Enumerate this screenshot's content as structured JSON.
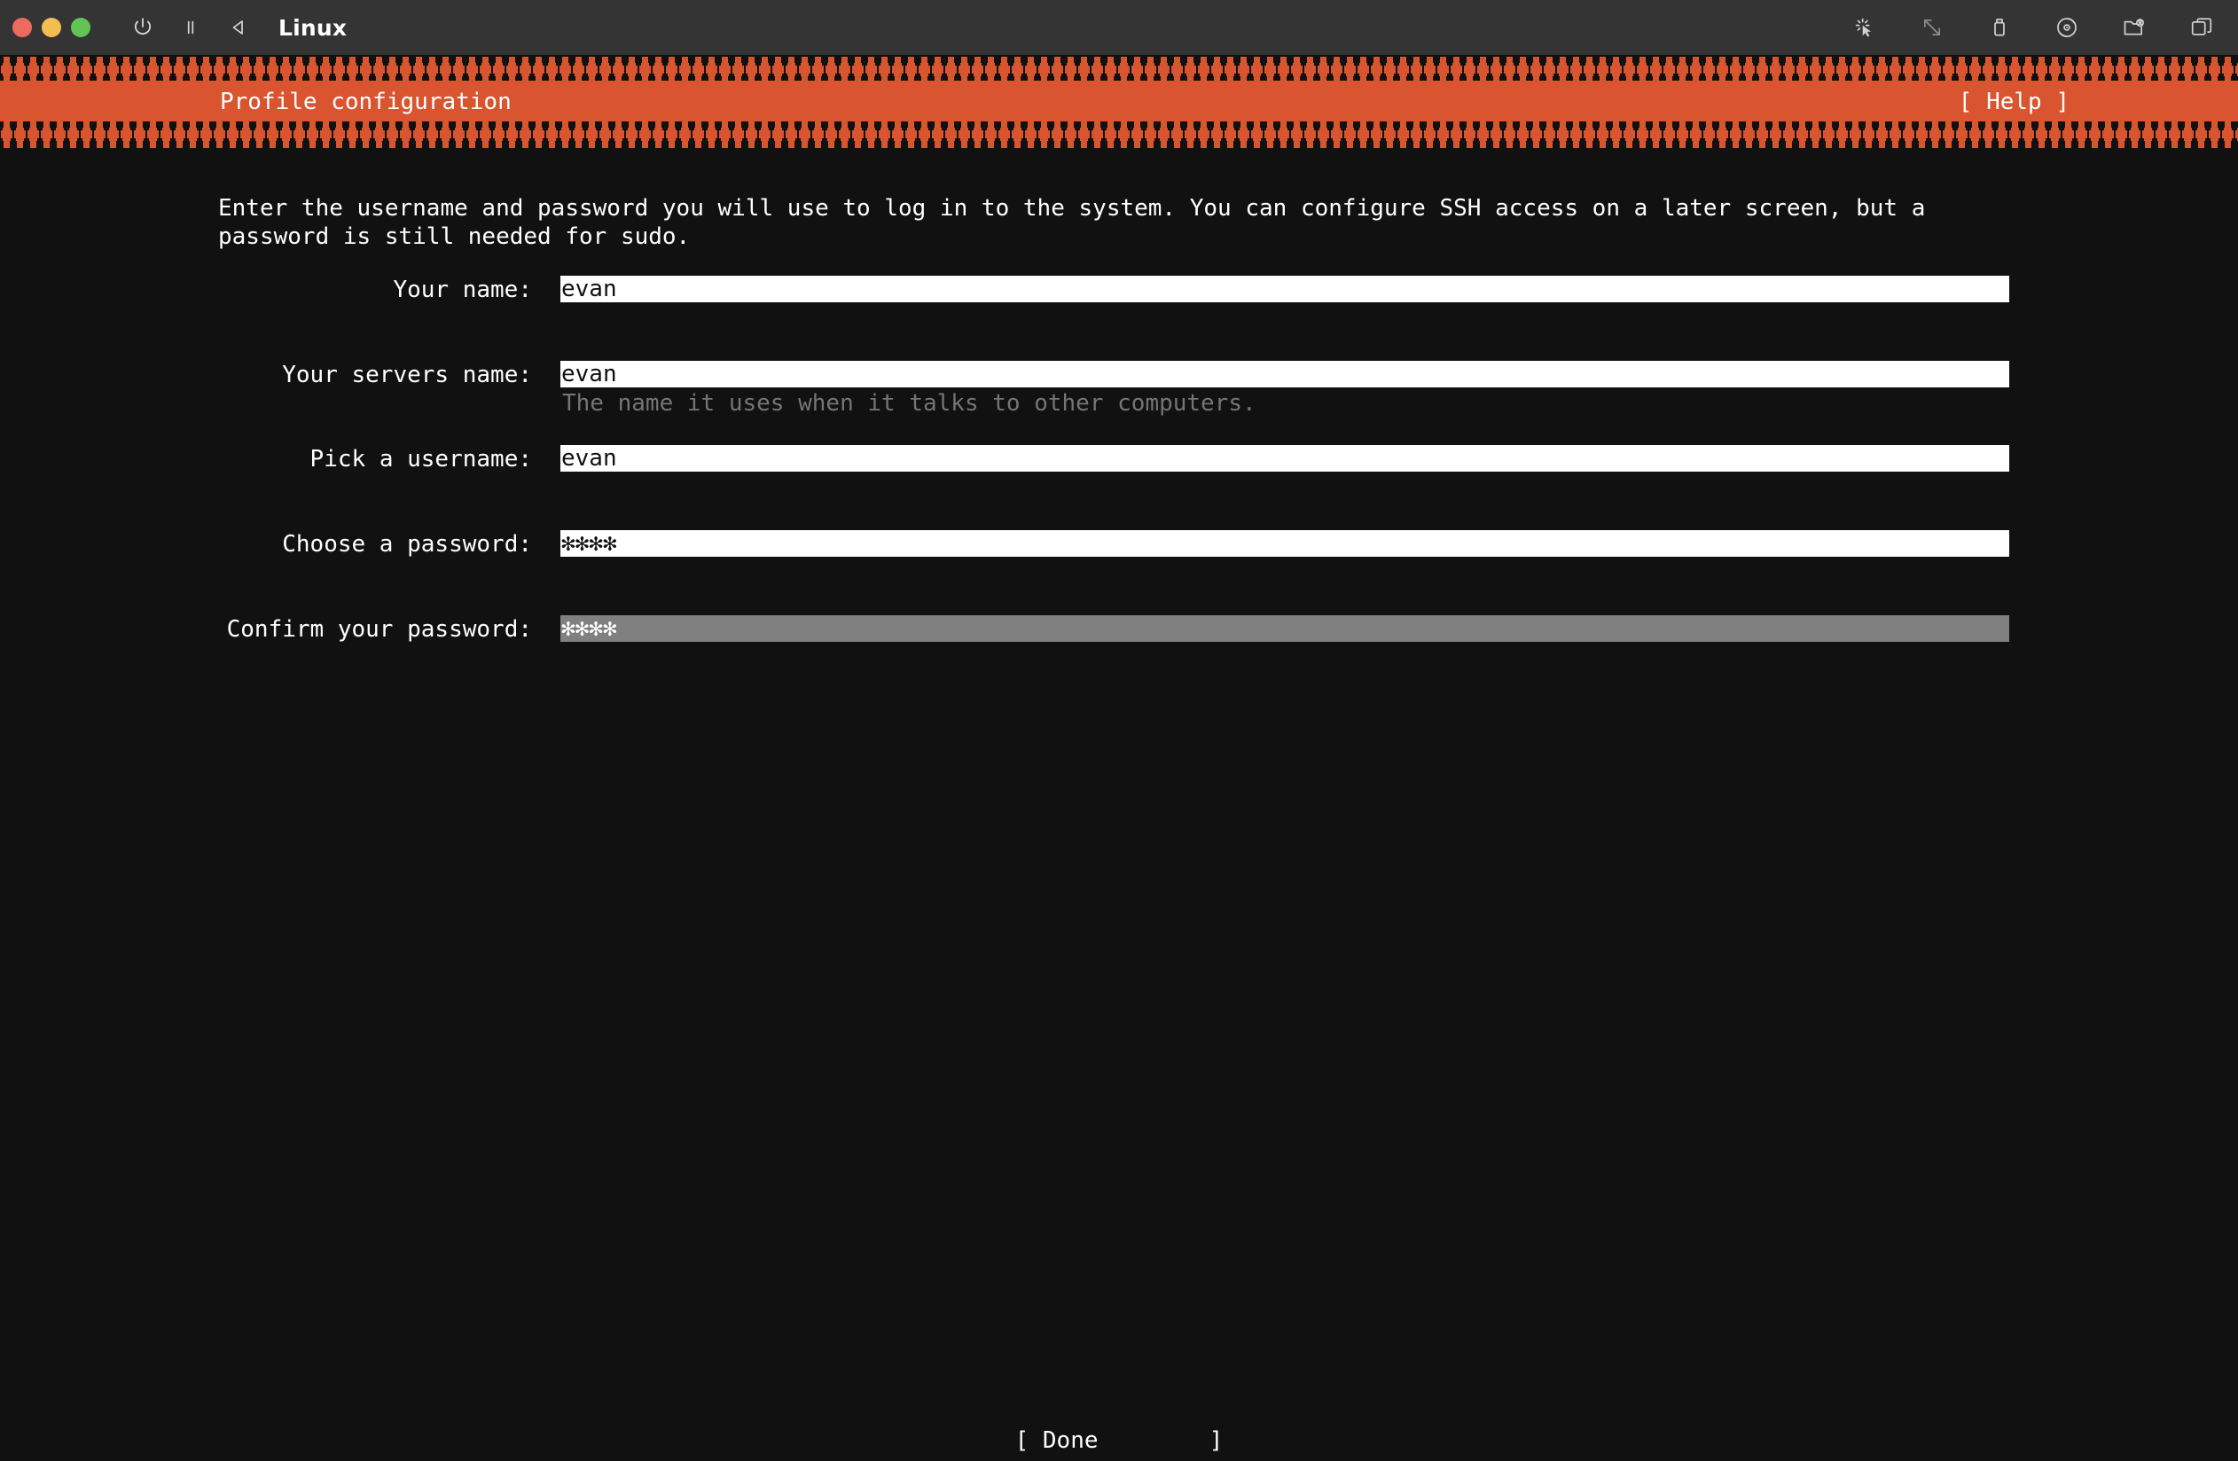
{
  "window": {
    "title": "Linux",
    "controls": [
      {
        "name": "close-button",
        "color": "#ed6a5e"
      },
      {
        "name": "minimize-button",
        "color": "#f4bd4f"
      },
      {
        "name": "maximize-button",
        "color": "#61c454"
      }
    ],
    "left_icons": [
      "power-icon",
      "pause-icon",
      "back-icon"
    ],
    "right_icons": [
      "pointer-click-icon",
      "resize-diagonal-icon",
      "usb-icon",
      "optical-disc-icon",
      "shared-folder-icon",
      "windows-stack-icon"
    ]
  },
  "header": {
    "title": "Profile configuration",
    "help_label": "[ Help ]",
    "accent_color": "#d9552f"
  },
  "intro": {
    "text": "Enter the username and password you will use to log in to the system. You can configure SSH access on a later screen, but a password is still needed for sudo."
  },
  "form": {
    "fields": [
      {
        "id": "name",
        "label": "Your name:",
        "value": "evan",
        "hint": "",
        "focused": false
      },
      {
        "id": "server",
        "label": "Your servers name:",
        "value": "evan",
        "hint": "The name it uses when it talks to other computers.",
        "focused": false
      },
      {
        "id": "username",
        "label": "Pick a username:",
        "value": "evan",
        "hint": "",
        "focused": false
      },
      {
        "id": "password",
        "label": "Choose a password:",
        "value": "✻✻✻✻",
        "hint": "",
        "focused": false
      },
      {
        "id": "confirm",
        "label": "Confirm your password:",
        "value": "✻✻✻✻",
        "hint": "",
        "focused": true
      }
    ]
  },
  "footer": {
    "done_label": "[ Done        ]"
  },
  "colors": {
    "background": "#111111",
    "titlebar": "#343434",
    "accent": "#d9552f",
    "field_background": "#ffffff",
    "field_focused_background": "#808080",
    "hint_text": "#757575"
  }
}
